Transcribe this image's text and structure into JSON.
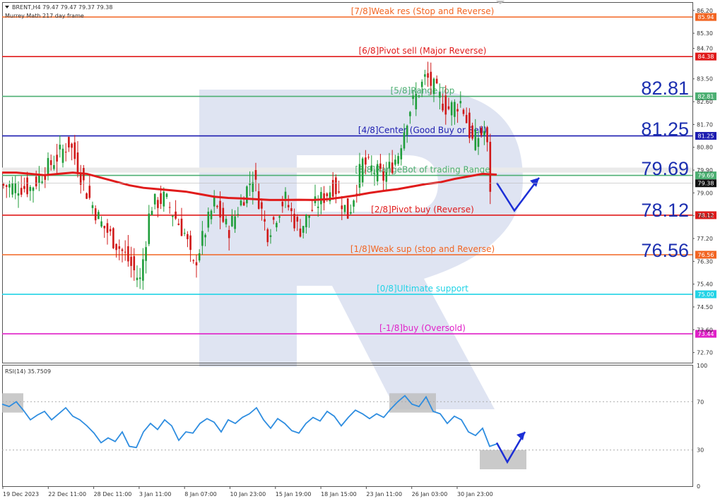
{
  "header": {
    "symbol_line": "BRENT,H4  79.47 79.47 79.37 79.38",
    "indicator_line": "Murrey Math 217 day frame"
  },
  "rsi": {
    "label": "RSI(14) 35.7509",
    "ticks": [
      "100",
      "70",
      "30",
      "0"
    ]
  },
  "big_labels": [
    "82.81",
    "81.25",
    "79.69",
    "78.12",
    "76.56"
  ],
  "chart_data": {
    "type": "line",
    "title": "",
    "price_ticks": [
      "86.20",
      "85.30",
      "84.70",
      "83.50",
      "82.60",
      "81.70",
      "80.80",
      "79.90",
      "79.00",
      "78.10",
      "77.20",
      "76.30",
      "75.40",
      "74.50",
      "73.60",
      "72.70"
    ],
    "ylim": [
      72.3,
      86.5
    ],
    "x_ticks": [
      "19 Dec 2023",
      "22 Dec 11:00",
      "28 Dec 11:00",
      "3 Jan 11:00",
      "8 Jan 07:00",
      "10 Jan 23:00",
      "15 Jan 19:00",
      "18 Jan 15:00",
      "23 Jan 11:00",
      "26 Jan 03:00",
      "30 Jan 23:00"
    ],
    "current_price": "79.38",
    "levels": [
      {
        "label": "[7/8]Weak res (Stop and Reverse)",
        "price": 85.94,
        "tag": "85.94",
        "color": "#f26522"
      },
      {
        "label": "[6/8]Pivot sell (Major Reverse)",
        "price": 84.38,
        "tag": "84.38",
        "color": "#e01b1b"
      },
      {
        "label": "[5/8]Range Top",
        "price": 82.81,
        "tag": "82.81",
        "color": "#4caf72"
      },
      {
        "label": "[4/8]Center (Good Buy or Sell)",
        "price": 81.25,
        "tag": "81.25",
        "color": "#1c1cb0"
      },
      {
        "label": "[3/8]RangeBot of trading Range",
        "price": 79.69,
        "tag": "79.69",
        "color": "#4caf72"
      },
      {
        "label": "[2/8]Pivot buy (Reverse)",
        "price": 78.12,
        "tag": "78.12",
        "color": "#e01b1b"
      },
      {
        "label": "[1/8]Weak sup (stop and Reverse)",
        "price": 76.56,
        "tag": "76.56",
        "color": "#f26522"
      },
      {
        "label": "[0/8]Ultimate support",
        "price": 75.0,
        "tag": "75.00",
        "color": "#22d3e6"
      },
      {
        "label": "[-1/8]buy (Oversold)",
        "price": 73.44,
        "tag": "73.44",
        "color": "#e020c8"
      }
    ],
    "ma_series": [
      [
        0,
        79.8
      ],
      [
        20,
        79.8
      ],
      [
        40,
        79.75
      ],
      [
        60,
        79.7
      ],
      [
        80,
        79.75
      ],
      [
        100,
        79.8
      ],
      [
        120,
        79.75
      ],
      [
        140,
        79.6
      ],
      [
        160,
        79.45
      ],
      [
        180,
        79.3
      ],
      [
        200,
        79.2
      ],
      [
        220,
        79.15
      ],
      [
        240,
        79.1
      ],
      [
        260,
        79.05
      ],
      [
        280,
        78.95
      ],
      [
        300,
        78.85
      ],
      [
        320,
        78.8
      ],
      [
        340,
        78.78
      ],
      [
        360,
        78.75
      ],
      [
        380,
        78.72
      ],
      [
        400,
        78.72
      ],
      [
        420,
        78.73
      ],
      [
        440,
        78.72
      ],
      [
        460,
        78.75
      ],
      [
        480,
        78.82
      ],
      [
        500,
        78.9
      ],
      [
        520,
        79.0
      ],
      [
        540,
        79.08
      ],
      [
        560,
        79.15
      ],
      [
        580,
        79.25
      ],
      [
        600,
        79.35
      ],
      [
        620,
        79.42
      ],
      [
        640,
        79.55
      ],
      [
        660,
        79.65
      ],
      [
        680,
        79.75
      ],
      [
        700,
        79.72
      ]
    ],
    "rsi_series": [
      [
        0,
        68
      ],
      [
        10,
        66
      ],
      [
        20,
        70
      ],
      [
        30,
        63
      ],
      [
        40,
        55
      ],
      [
        50,
        59
      ],
      [
        60,
        62
      ],
      [
        70,
        55
      ],
      [
        80,
        60
      ],
      [
        90,
        65
      ],
      [
        100,
        58
      ],
      [
        110,
        55
      ],
      [
        120,
        50
      ],
      [
        130,
        44
      ],
      [
        140,
        36
      ],
      [
        150,
        40
      ],
      [
        160,
        37
      ],
      [
        170,
        45
      ],
      [
        180,
        33
      ],
      [
        190,
        32
      ],
      [
        200,
        45
      ],
      [
        210,
        52
      ],
      [
        220,
        47
      ],
      [
        230,
        55
      ],
      [
        240,
        50
      ],
      [
        250,
        38
      ],
      [
        260,
        45
      ],
      [
        270,
        44
      ],
      [
        280,
        52
      ],
      [
        290,
        56
      ],
      [
        300,
        53
      ],
      [
        310,
        45
      ],
      [
        320,
        55
      ],
      [
        330,
        52
      ],
      [
        340,
        57
      ],
      [
        350,
        60
      ],
      [
        360,
        65
      ],
      [
        370,
        55
      ],
      [
        380,
        48
      ],
      [
        390,
        56
      ],
      [
        400,
        52
      ],
      [
        410,
        46
      ],
      [
        420,
        44
      ],
      [
        430,
        52
      ],
      [
        440,
        57
      ],
      [
        450,
        54
      ],
      [
        460,
        62
      ],
      [
        470,
        58
      ],
      [
        480,
        50
      ],
      [
        490,
        57
      ],
      [
        500,
        63
      ],
      [
        510,
        60
      ],
      [
        520,
        56
      ],
      [
        530,
        60
      ],
      [
        540,
        57
      ],
      [
        550,
        64
      ],
      [
        560,
        70
      ],
      [
        570,
        75
      ],
      [
        580,
        68
      ],
      [
        590,
        66
      ],
      [
        600,
        74
      ],
      [
        610,
        62
      ],
      [
        620,
        60
      ],
      [
        630,
        52
      ],
      [
        640,
        58
      ],
      [
        650,
        55
      ],
      [
        660,
        45
      ],
      [
        670,
        42
      ],
      [
        680,
        48
      ],
      [
        690,
        33
      ],
      [
        700,
        35
      ]
    ],
    "rsi_ylim": [
      0,
      100
    ],
    "forecast_price": [
      [
        700,
        79.4
      ],
      [
        725,
        78.3
      ],
      [
        760,
        79.6
      ]
    ],
    "forecast_rsi": [
      [
        700,
        36
      ],
      [
        715,
        20
      ],
      [
        740,
        45
      ]
    ],
    "shaded_price_zone": [
      79.8,
      80.0
    ],
    "shaded_rsi_zones": [
      {
        "x0": 0,
        "x1": 30,
        "y0": 61,
        "y1": 77
      },
      {
        "x0": 548,
        "x1": 614,
        "y0": 61,
        "y1": 77
      },
      {
        "x0": 676,
        "x1": 742,
        "y0": 14,
        "y1": 30
      }
    ]
  }
}
